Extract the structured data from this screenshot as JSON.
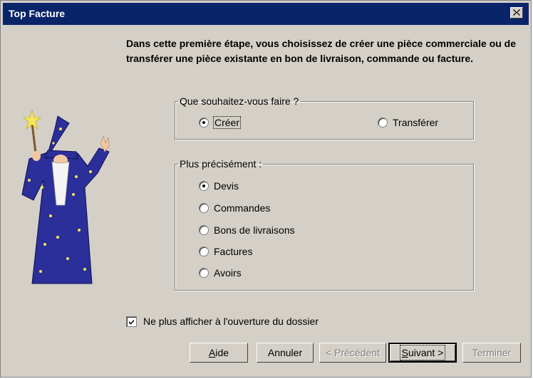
{
  "window": {
    "title": "Top Facture"
  },
  "intro_text": "Dans cette première étape, vous choisissez de créer une pièce commerciale ou de transférer une pièce existante en bon de livraison, commande ou facture.",
  "action_group": {
    "legend": "Que souhaitez-vous faire ?",
    "options": [
      {
        "label": "Créer",
        "checked": true
      },
      {
        "label": "Transférer",
        "checked": false
      }
    ]
  },
  "detail_group": {
    "legend": "Plus précisément :",
    "options": [
      {
        "label": "Devis",
        "checked": true
      },
      {
        "label": "Commandes",
        "checked": false
      },
      {
        "label": "Bons de livraisons",
        "checked": false
      },
      {
        "label": "Factures",
        "checked": false
      },
      {
        "label": "Avoirs",
        "checked": false
      }
    ]
  },
  "checkbox": {
    "label": "Ne plus afficher à l'ouverture du dossier",
    "checked": true
  },
  "buttons": {
    "help_pre": "",
    "help_u": "A",
    "help_post": "ide",
    "cancel": "Annuler",
    "previous": "< Précédent",
    "next_pre": "",
    "next_u": "S",
    "next_post": "uivant >",
    "finish": "Terminer"
  },
  "colors": {
    "titlebar": "#0a246a",
    "face": "#d4d0c8",
    "wizard_robe": "#2b2f9a"
  },
  "icons": {
    "close": "close-icon",
    "wizard": "wizard-illustration"
  }
}
